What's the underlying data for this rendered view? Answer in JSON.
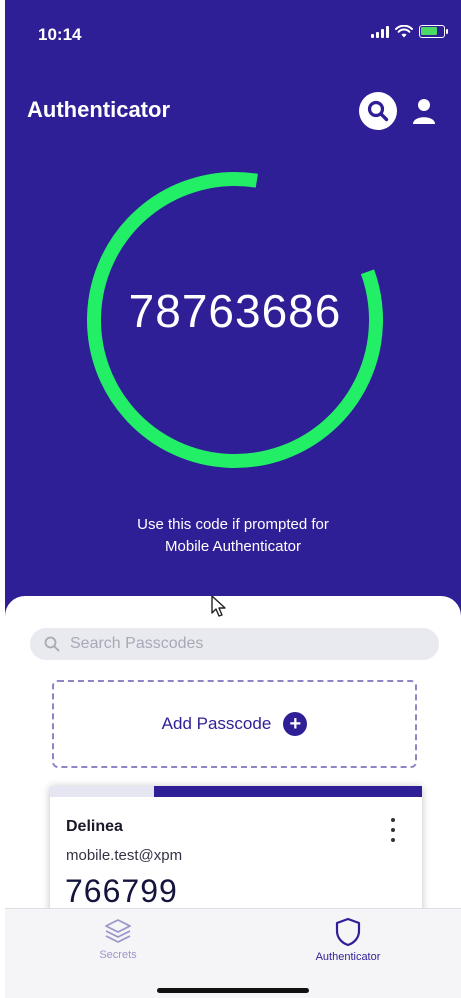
{
  "status_bar": {
    "time": "10:14"
  },
  "header": {
    "title": "Authenticator"
  },
  "main": {
    "code": "78763686",
    "timer_remaining_fraction": 0.83,
    "hint": "Use this code if prompted for\nMobile Authenticator"
  },
  "search": {
    "placeholder": "Search Passcodes"
  },
  "add_passcode": {
    "label": "Add Passcode"
  },
  "passcodes": [
    {
      "name": "Delinea",
      "account": "mobile.test@xpm",
      "code": "766799",
      "remaining_fraction": 0.72
    }
  ],
  "tabs": [
    {
      "label": "Secrets",
      "icon": "layers-icon",
      "active": false
    },
    {
      "label": "Authenticator",
      "icon": "shield-icon",
      "active": true
    }
  ],
  "colors": {
    "brand": "#2f1f96",
    "ring": "#22ee66",
    "sheet": "#ffffff"
  }
}
